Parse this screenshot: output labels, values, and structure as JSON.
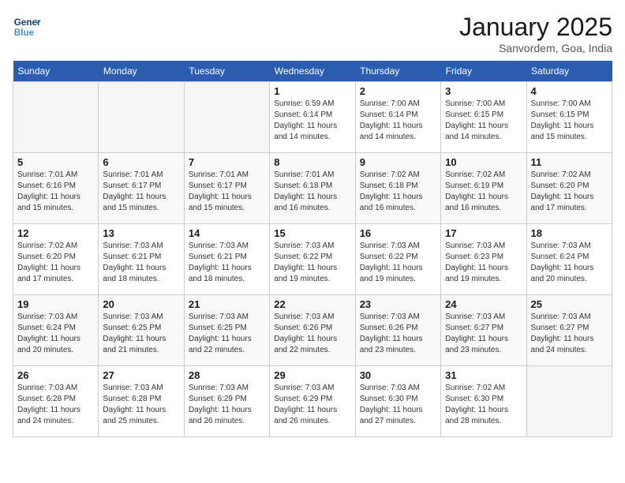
{
  "logo": {
    "line1": "General",
    "line2": "Blue"
  },
  "title": "January 2025",
  "subtitle": "Sanvordem, Goa, India",
  "weekdays": [
    "Sunday",
    "Monday",
    "Tuesday",
    "Wednesday",
    "Thursday",
    "Friday",
    "Saturday"
  ],
  "weeks": [
    [
      {
        "day": "",
        "info": ""
      },
      {
        "day": "",
        "info": ""
      },
      {
        "day": "",
        "info": ""
      },
      {
        "day": "1",
        "info": "Sunrise: 6:59 AM\nSunset: 6:14 PM\nDaylight: 11 hours\nand 14 minutes."
      },
      {
        "day": "2",
        "info": "Sunrise: 7:00 AM\nSunset: 6:14 PM\nDaylight: 11 hours\nand 14 minutes."
      },
      {
        "day": "3",
        "info": "Sunrise: 7:00 AM\nSunset: 6:15 PM\nDaylight: 11 hours\nand 14 minutes."
      },
      {
        "day": "4",
        "info": "Sunrise: 7:00 AM\nSunset: 6:15 PM\nDaylight: 11 hours\nand 15 minutes."
      }
    ],
    [
      {
        "day": "5",
        "info": "Sunrise: 7:01 AM\nSunset: 6:16 PM\nDaylight: 11 hours\nand 15 minutes."
      },
      {
        "day": "6",
        "info": "Sunrise: 7:01 AM\nSunset: 6:17 PM\nDaylight: 11 hours\nand 15 minutes."
      },
      {
        "day": "7",
        "info": "Sunrise: 7:01 AM\nSunset: 6:17 PM\nDaylight: 11 hours\nand 15 minutes."
      },
      {
        "day": "8",
        "info": "Sunrise: 7:01 AM\nSunset: 6:18 PM\nDaylight: 11 hours\nand 16 minutes."
      },
      {
        "day": "9",
        "info": "Sunrise: 7:02 AM\nSunset: 6:18 PM\nDaylight: 11 hours\nand 16 minutes."
      },
      {
        "day": "10",
        "info": "Sunrise: 7:02 AM\nSunset: 6:19 PM\nDaylight: 11 hours\nand 16 minutes."
      },
      {
        "day": "11",
        "info": "Sunrise: 7:02 AM\nSunset: 6:20 PM\nDaylight: 11 hours\nand 17 minutes."
      }
    ],
    [
      {
        "day": "12",
        "info": "Sunrise: 7:02 AM\nSunset: 6:20 PM\nDaylight: 11 hours\nand 17 minutes."
      },
      {
        "day": "13",
        "info": "Sunrise: 7:03 AM\nSunset: 6:21 PM\nDaylight: 11 hours\nand 18 minutes."
      },
      {
        "day": "14",
        "info": "Sunrise: 7:03 AM\nSunset: 6:21 PM\nDaylight: 11 hours\nand 18 minutes."
      },
      {
        "day": "15",
        "info": "Sunrise: 7:03 AM\nSunset: 6:22 PM\nDaylight: 11 hours\nand 19 minutes."
      },
      {
        "day": "16",
        "info": "Sunrise: 7:03 AM\nSunset: 6:22 PM\nDaylight: 11 hours\nand 19 minutes."
      },
      {
        "day": "17",
        "info": "Sunrise: 7:03 AM\nSunset: 6:23 PM\nDaylight: 11 hours\nand 19 minutes."
      },
      {
        "day": "18",
        "info": "Sunrise: 7:03 AM\nSunset: 6:24 PM\nDaylight: 11 hours\nand 20 minutes."
      }
    ],
    [
      {
        "day": "19",
        "info": "Sunrise: 7:03 AM\nSunset: 6:24 PM\nDaylight: 11 hours\nand 20 minutes."
      },
      {
        "day": "20",
        "info": "Sunrise: 7:03 AM\nSunset: 6:25 PM\nDaylight: 11 hours\nand 21 minutes."
      },
      {
        "day": "21",
        "info": "Sunrise: 7:03 AM\nSunset: 6:25 PM\nDaylight: 11 hours\nand 22 minutes."
      },
      {
        "day": "22",
        "info": "Sunrise: 7:03 AM\nSunset: 6:26 PM\nDaylight: 11 hours\nand 22 minutes."
      },
      {
        "day": "23",
        "info": "Sunrise: 7:03 AM\nSunset: 6:26 PM\nDaylight: 11 hours\nand 23 minutes."
      },
      {
        "day": "24",
        "info": "Sunrise: 7:03 AM\nSunset: 6:27 PM\nDaylight: 11 hours\nand 23 minutes."
      },
      {
        "day": "25",
        "info": "Sunrise: 7:03 AM\nSunset: 6:27 PM\nDaylight: 11 hours\nand 24 minutes."
      }
    ],
    [
      {
        "day": "26",
        "info": "Sunrise: 7:03 AM\nSunset: 6:28 PM\nDaylight: 11 hours\nand 24 minutes."
      },
      {
        "day": "27",
        "info": "Sunrise: 7:03 AM\nSunset: 6:28 PM\nDaylight: 11 hours\nand 25 minutes."
      },
      {
        "day": "28",
        "info": "Sunrise: 7:03 AM\nSunset: 6:29 PM\nDaylight: 11 hours\nand 26 minutes."
      },
      {
        "day": "29",
        "info": "Sunrise: 7:03 AM\nSunset: 6:29 PM\nDaylight: 11 hours\nand 26 minutes."
      },
      {
        "day": "30",
        "info": "Sunrise: 7:03 AM\nSunset: 6:30 PM\nDaylight: 11 hours\nand 27 minutes."
      },
      {
        "day": "31",
        "info": "Sunrise: 7:02 AM\nSunset: 6:30 PM\nDaylight: 11 hours\nand 28 minutes."
      },
      {
        "day": "",
        "info": ""
      }
    ]
  ]
}
